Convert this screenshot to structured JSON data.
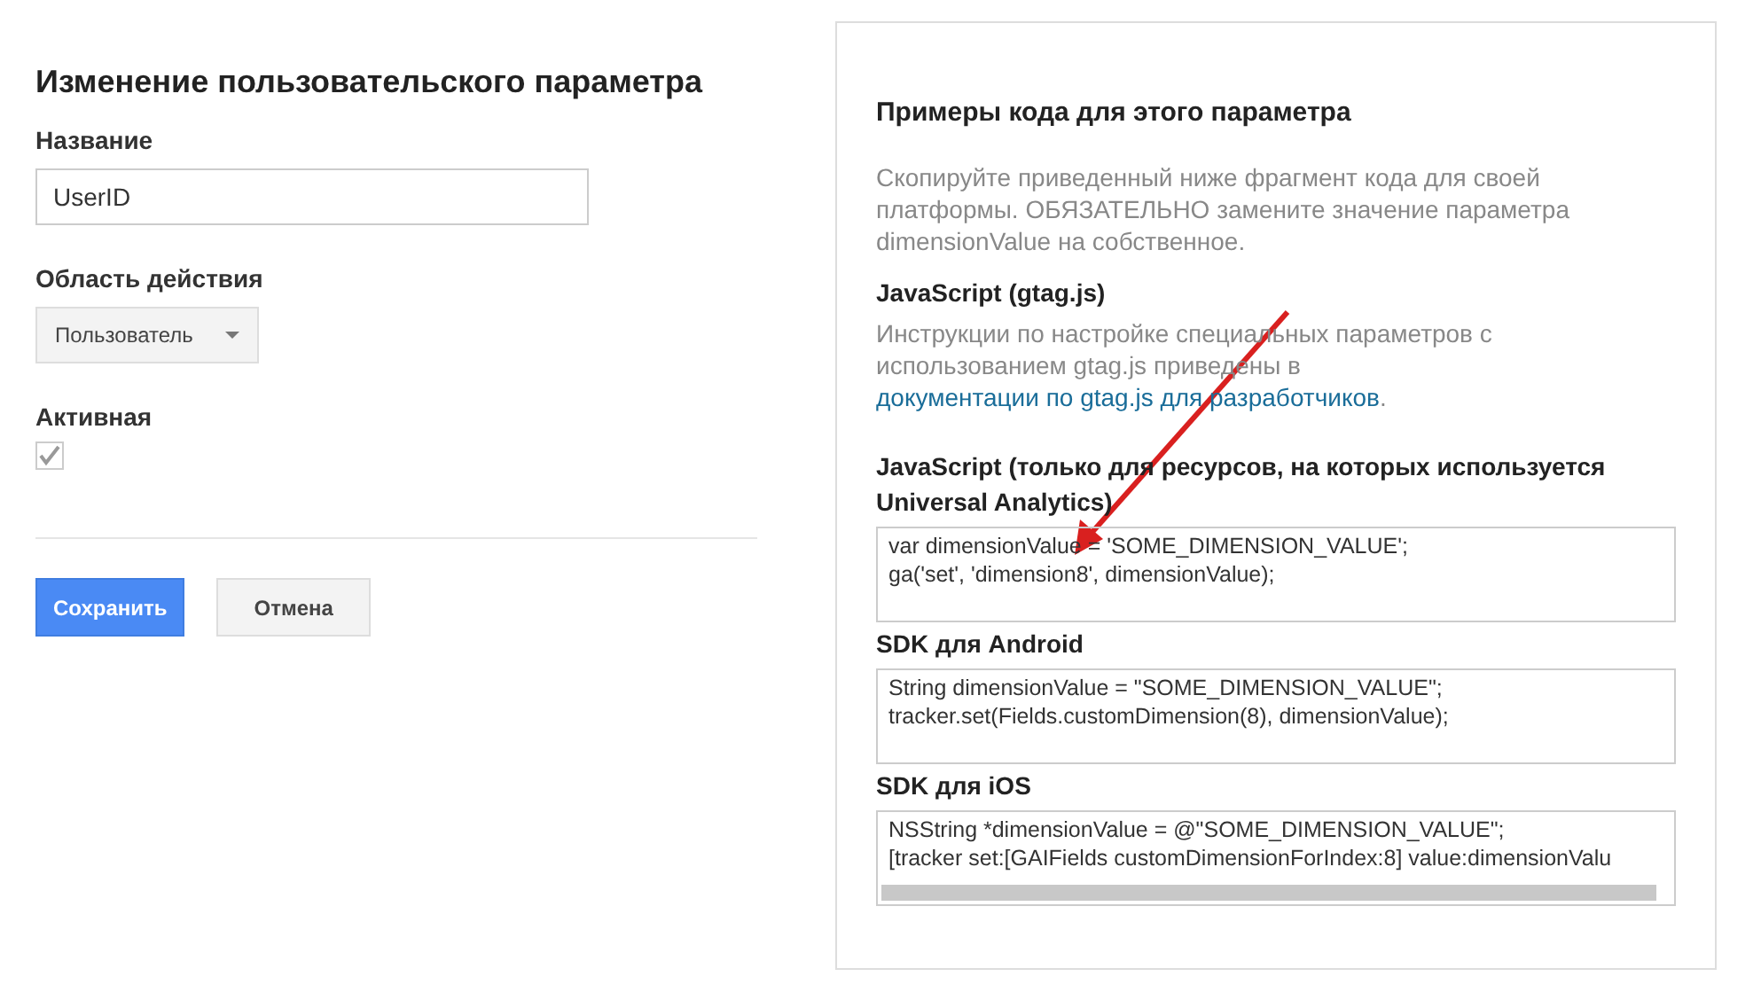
{
  "form": {
    "title": "Изменение пользовательского параметра",
    "name_label": "Название",
    "name_value": "UserID",
    "scope_label": "Область действия",
    "scope_value": "Пользователь",
    "active_label": "Активная",
    "active_checked": true,
    "buttons": [
      {
        "label": "Сохранить",
        "kind": "primary"
      },
      {
        "label": "Отмена",
        "kind": "secondary"
      }
    ]
  },
  "panel": {
    "title": "Примеры кода для этого параметра",
    "intro": "Скопируйте приведенный ниже фрагмент кода для своей платформы. ОБЯЗАТЕЛЬНО замените значение параметра dimensionValue на собственное.",
    "sections": [
      {
        "kind": "text",
        "heading": "JavaScript (gtag.js)",
        "text": "Инструкции по настройке специальных параметров с использованием gtag.js приведены в ",
        "link": "документации по gtag.js для разработчиков",
        "after": "."
      },
      {
        "kind": "code",
        "heading": "JavaScript (только для ресурсов, на которых используется Universal Analytics)",
        "lines": [
          "var dimensionValue = 'SOME_DIMENSION_VALUE';",
          "ga('set', 'dimension8', dimensionValue);"
        ]
      },
      {
        "kind": "code",
        "heading": "SDK для Android",
        "lines": [
          "String dimensionValue = \"SOME_DIMENSION_VALUE\";",
          "tracker.set(Fields.customDimension(8), dimensionValue);"
        ]
      },
      {
        "kind": "code",
        "heading": "SDK для iOS",
        "lines": [
          "NSString *dimensionValue = @\"SOME_DIMENSION_VALUE\";",
          "[tracker set:[GAIFields customDimensionForIndex:8] value:dimensionValu"
        ],
        "scrollbar": true
      }
    ]
  },
  "annotation": {
    "kind": "arrow"
  }
}
